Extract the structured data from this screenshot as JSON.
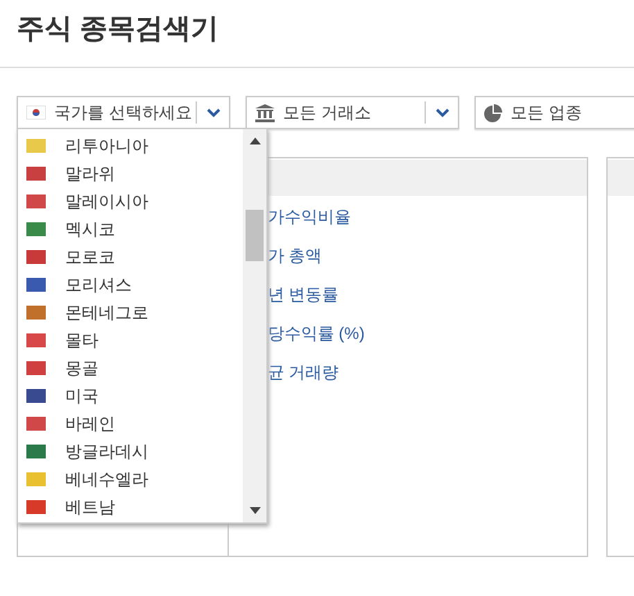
{
  "title": "주식 종목검색기",
  "filters": [
    {
      "kind": "country",
      "value": "국가를 선택하세요",
      "dropdown": true
    },
    {
      "kind": "exchange",
      "value": "모든 거래소",
      "dropdown": true
    },
    {
      "kind": "sector",
      "value": "모든 업종",
      "dropdown": false
    }
  ],
  "country_list": [
    {
      "name": "리투아니아",
      "color": "#e8c94a"
    },
    {
      "name": "말라위",
      "color": "#c84040"
    },
    {
      "name": "말레이시아",
      "color": "#d04848"
    },
    {
      "name": "멕시코",
      "color": "#3a8a4a"
    },
    {
      "name": "모로코",
      "color": "#c83a3a"
    },
    {
      "name": "모리셔스",
      "color": "#3a5ab0"
    },
    {
      "name": "몬테네그로",
      "color": "#c0702a"
    },
    {
      "name": "몰타",
      "color": "#d84848"
    },
    {
      "name": "몽골",
      "color": "#d04040"
    },
    {
      "name": "미국",
      "color": "#3a4a90"
    },
    {
      "name": "바레인",
      "color": "#d04848"
    },
    {
      "name": "방글라데시",
      "color": "#2a7a4a"
    },
    {
      "name": "베네수엘라",
      "color": "#e8c030"
    },
    {
      "name": "베트남",
      "color": "#d83a2a"
    }
  ],
  "criteria": [
    "가수익비율",
    "가 총액",
    "년 변동률",
    "당수익률 (%)",
    "균 거래량"
  ]
}
